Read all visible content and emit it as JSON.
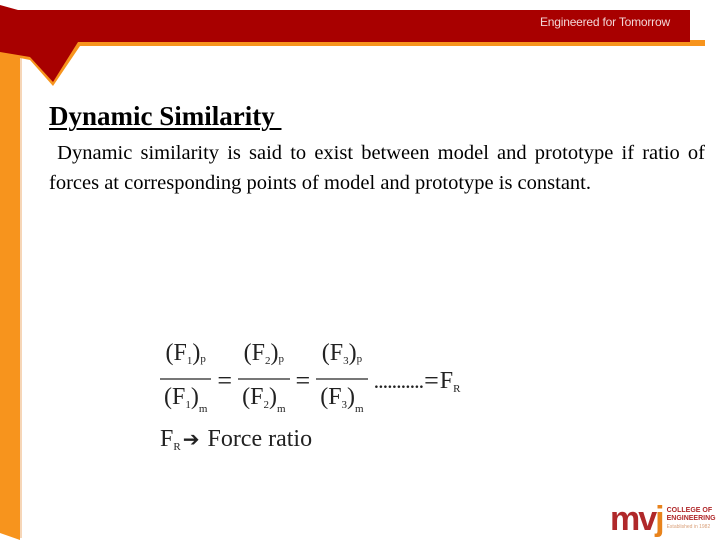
{
  "header": {
    "tagline": "Engineered for Tomorrow",
    "colors": {
      "band": "#a80000",
      "accent": "#f7941d"
    }
  },
  "slide": {
    "title": "Dynamic Similarity ",
    "body": " Dynamic similarity is said to exist between model and prototype if ratio of forces at corresponding points of model and prototype is constant.",
    "equation": {
      "terms": [
        {
          "num_symbol": "F",
          "num_index": "1",
          "num_sub": "p",
          "den_symbol": "F",
          "den_index": "1",
          "den_sub": "m"
        },
        {
          "num_symbol": "F",
          "num_index": "2",
          "num_sub": "p",
          "den_symbol": "F",
          "den_index": "2",
          "den_sub": "m"
        },
        {
          "num_symbol": "F",
          "num_index": "3",
          "num_sub": "p",
          "den_symbol": "F",
          "den_index": "3",
          "den_sub": "m"
        }
      ],
      "equals": "=",
      "dots": "...........",
      "result_symbol": "F",
      "result_sub": "R"
    },
    "definition": {
      "symbol": "F",
      "sub": "R",
      "arrow": "➔",
      "text": " Force ratio"
    }
  },
  "logo": {
    "mark": "mv",
    "mark_j": "j",
    "line1": "COLLEGE OF",
    "line2": "ENGINEERING",
    "line3": "Established in 1982"
  }
}
